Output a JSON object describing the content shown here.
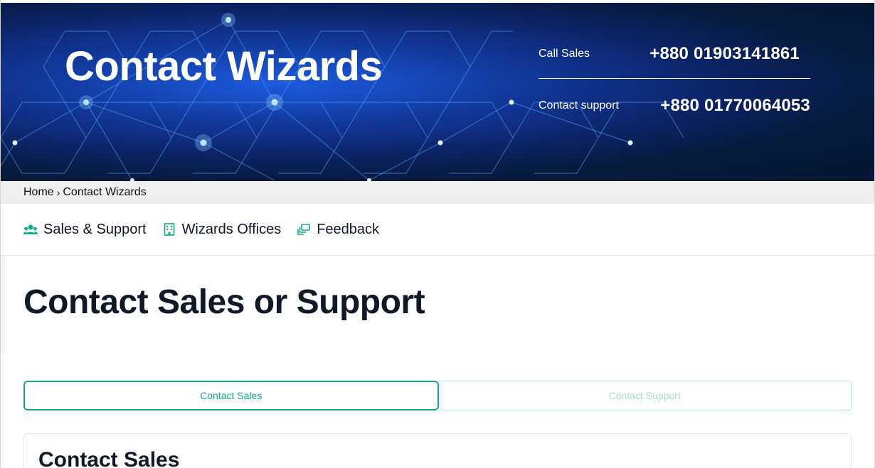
{
  "hero": {
    "title": "Contact Wizards",
    "contacts": [
      {
        "label": "Call Sales",
        "phone": "+880 01903141861"
      },
      {
        "label": "Contact support",
        "phone": "+880 01770064053"
      }
    ]
  },
  "breadcrumb": {
    "home": "Home",
    "separator": "›",
    "current": "Contact Wizards"
  },
  "nav": {
    "items": [
      {
        "label": "Sales & Support",
        "icon": "users-icon"
      },
      {
        "label": "Wizards Offices",
        "icon": "building-icon"
      },
      {
        "label": "Feedback",
        "icon": "feedback-icon"
      }
    ]
  },
  "main": {
    "title": "Contact Sales or Support",
    "toggle": {
      "sales_label": "Contact Sales",
      "support_label": "Contact Support",
      "active": "sales"
    },
    "card_title": "Contact Sales"
  },
  "colors": {
    "accent": "#14a88a",
    "accent_light": "#a7dccd",
    "hero_dark": "#071633",
    "hero_blue": "#1d5be0",
    "text": "#111827"
  }
}
